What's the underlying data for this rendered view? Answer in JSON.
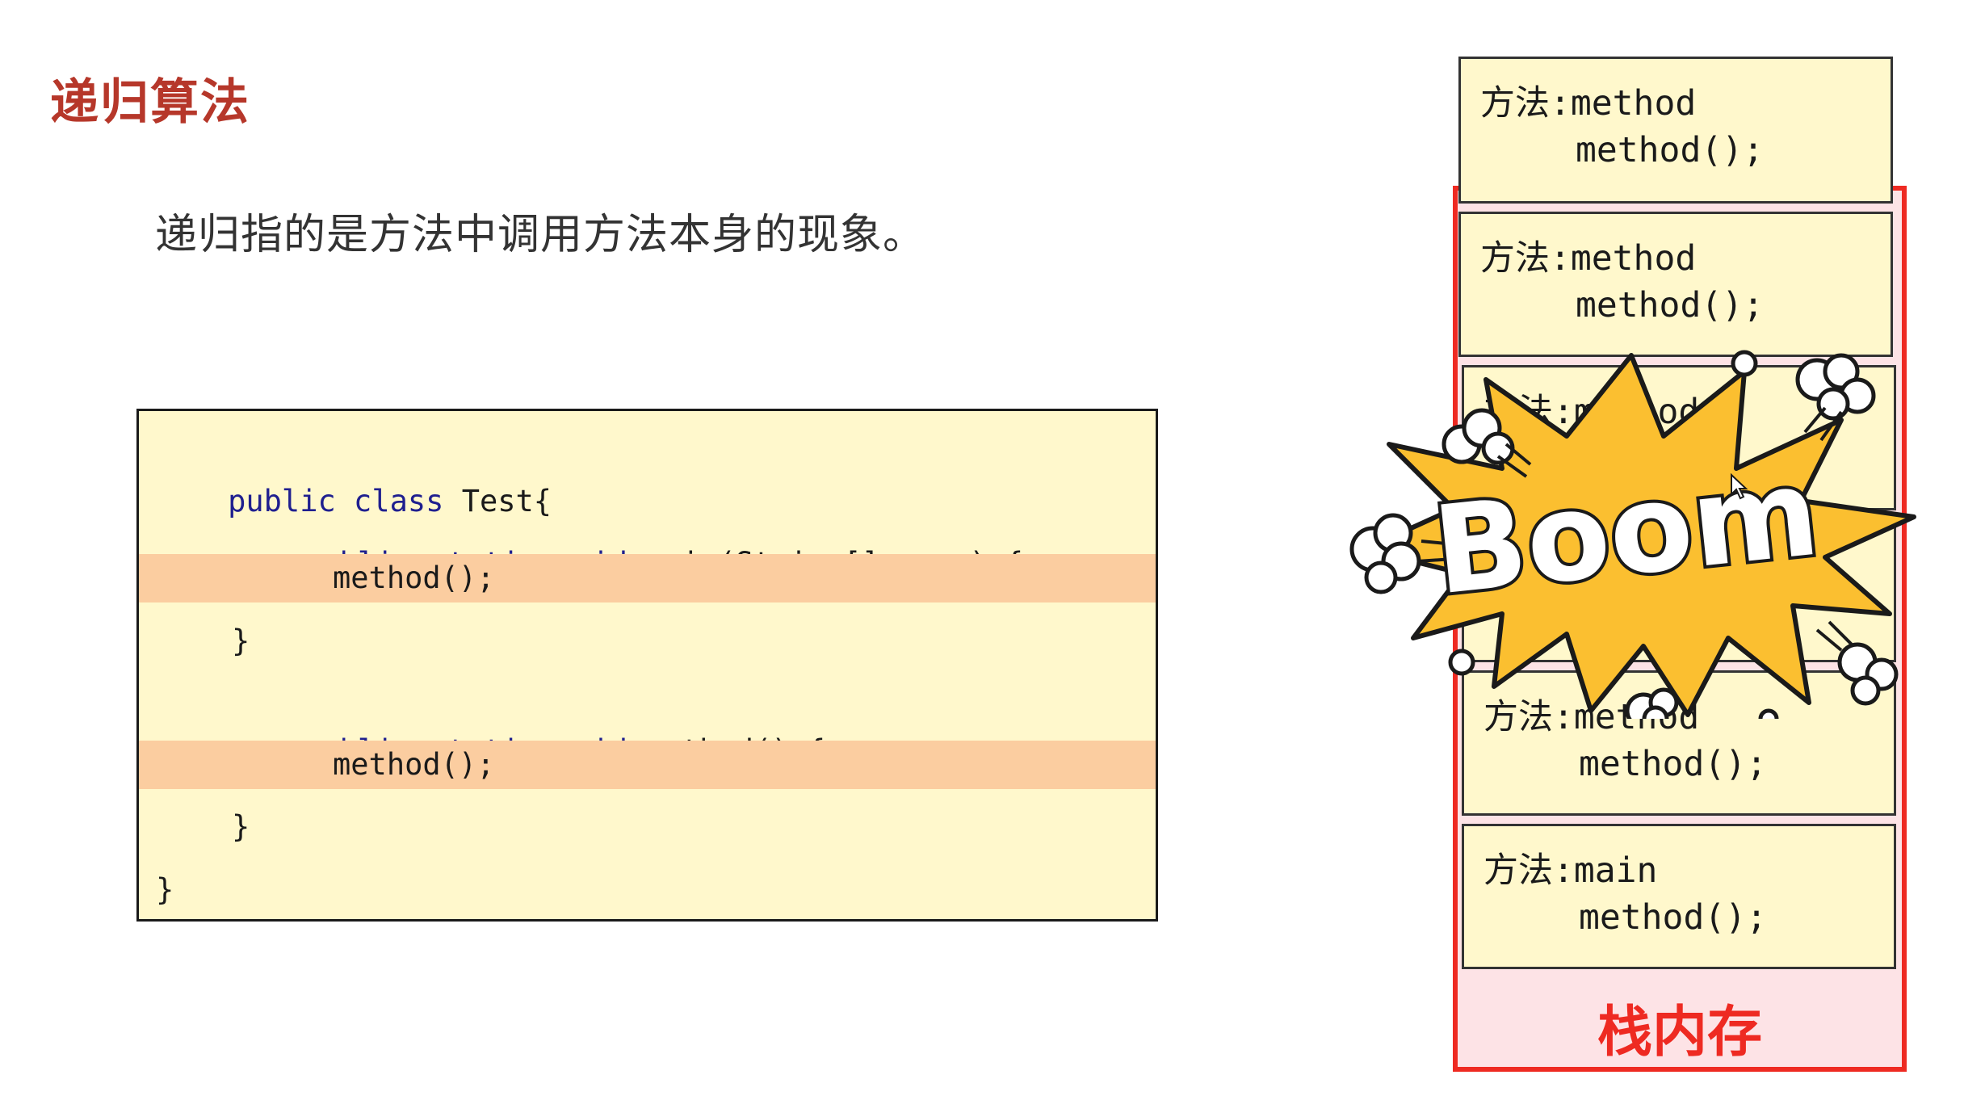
{
  "slide": {
    "title": "递归算法",
    "definition": "递归指的是方法中调用方法本身的现象。"
  },
  "code": {
    "lines": [
      "public class Test{",
      "    public static void main(String[] args) {",
      "        method();",
      "    }",
      "    public static void method() {",
      "        method();",
      "    }",
      "}"
    ],
    "highlighted_lines": [
      2,
      5
    ],
    "highlight_color": "#fbcda0",
    "background_color": "#fff8cc"
  },
  "stack": {
    "label": "栈内存",
    "border_color": "#ee2a22",
    "background_color": "#fde3e6",
    "frames": [
      {
        "name": "方法:method",
        "call": "method();"
      },
      {
        "name": "方法:method",
        "call": "method();"
      },
      {
        "name": "方法:method",
        "call": ""
      },
      {
        "name": "",
        "call": ""
      },
      {
        "name": "方法:method",
        "call": "method();"
      },
      {
        "name": "方法:main",
        "call": "method();"
      }
    ]
  },
  "overlay": {
    "boom_text": "Boom",
    "burst_color": "#fbbf30"
  },
  "icons": [
    "cursor-icon",
    "explosion-burst-icon",
    "cloud-puff-icon"
  ]
}
